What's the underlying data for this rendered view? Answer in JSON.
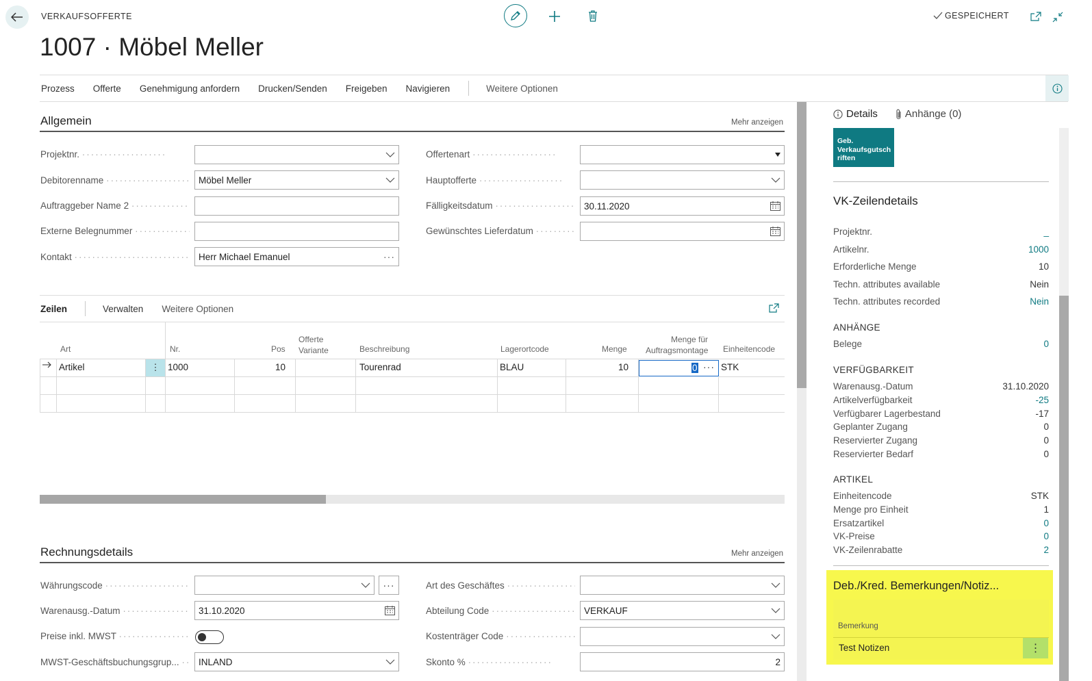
{
  "header": {
    "kicker": "VERKAUFSOFFERTE",
    "title": "1007 · Möbel Meller",
    "status": "GESPEICHERT"
  },
  "actions": {
    "items": [
      "Prozess",
      "Offerte",
      "Genehmigung anfordern",
      "Drucken/Senden",
      "Freigeben",
      "Navigieren"
    ],
    "more": "Weitere Optionen"
  },
  "general": {
    "title": "Allgemein",
    "more": "Mehr anzeigen",
    "left_fields": [
      {
        "label": "Projektnr.",
        "value": "",
        "control": "dropdown"
      },
      {
        "label": "Debitorenname",
        "value": "Möbel Meller",
        "control": "dropdown"
      },
      {
        "label": "Auftraggeber Name 2",
        "value": "",
        "control": "text"
      },
      {
        "label": "Externe Belegnummer",
        "value": "",
        "control": "text"
      },
      {
        "label": "Kontakt",
        "value": "Herr Michael Emanuel",
        "control": "ellipsis"
      }
    ],
    "right_fields": [
      {
        "label": "Offertenart",
        "value": "",
        "control": "select"
      },
      {
        "label": "Hauptofferte",
        "value": "",
        "control": "dropdown"
      },
      {
        "label": "Fälligkeitsdatum",
        "value": "30.11.2020",
        "control": "date"
      },
      {
        "label": "Gewünschtes Lieferdatum",
        "value": "",
        "control": "date"
      }
    ]
  },
  "lines": {
    "tab": "Zeilen",
    "manage": "Verwalten",
    "more": "Weitere Optionen",
    "columns": {
      "art": "Art",
      "nr": "Nr.",
      "pos": "Pos",
      "variante_1": "Offerte",
      "variante_2": "Variante",
      "beschreibung": "Beschreibung",
      "lagerort": "Lagerortcode",
      "menge": "Menge",
      "montage_1": "Menge für",
      "montage_2": "Auftragsmontage",
      "einheit": "Einheitencode"
    },
    "row": {
      "art": "Artikel",
      "nr": "1000",
      "pos": "10",
      "variante": "",
      "beschreibung": "Tourenrad",
      "lagerort": "BLAU",
      "menge": "10",
      "montage": "0",
      "einheit": "STK"
    }
  },
  "invoice": {
    "title": "Rechnungsdetails",
    "more": "Mehr anzeigen",
    "left_fields": [
      {
        "label": "Währungscode",
        "value": ""
      },
      {
        "label": "Warenausg.-Datum",
        "value": "31.10.2020"
      },
      {
        "label": "Preise inkl. MWST",
        "value": ""
      },
      {
        "label": "MWST-Geschäftsbuchungsgrup...",
        "value": "INLAND"
      }
    ],
    "right_fields": [
      {
        "label": "Art des Geschäftes",
        "value": ""
      },
      {
        "label": "Abteilung Code",
        "value": "VERKAUF"
      },
      {
        "label": "Kostenträger Code",
        "value": ""
      },
      {
        "label": "Skonto %",
        "value": "2"
      }
    ]
  },
  "panel": {
    "tab_details": "Details",
    "tab_attachments": "Anhänge (0)",
    "tile": "Geb. Verkaufsgutsch riften",
    "line_details_title": "VK-Zeilendetails",
    "line_details": [
      {
        "label": "Projektnr.",
        "value": "_",
        "link": true
      },
      {
        "label": "Artikelnr.",
        "value": "1000",
        "link": true
      },
      {
        "label": "Erforderliche Menge",
        "value": "10",
        "link": false
      },
      {
        "label": "Techn. attributes available",
        "value": "Nein",
        "link": false
      },
      {
        "label": "Techn. attributes recorded",
        "value": "Nein",
        "link": true
      }
    ],
    "attachments_caption": "ANHÄNGE",
    "attachments": [
      {
        "label": "Belege",
        "value": "0",
        "link": true
      }
    ],
    "availability_caption": "VERFÜGBARKEIT",
    "availability": [
      {
        "label": "Warenausg.-Datum",
        "value": "31.10.2020",
        "link": false
      },
      {
        "label": "Artikelverfügbarkeit",
        "value": "-25",
        "link": true
      },
      {
        "label": "Verfügbarer Lagerbestand",
        "value": "-17",
        "link": false
      },
      {
        "label": "Geplanter Zugang",
        "value": "0",
        "link": false
      },
      {
        "label": "Reservierter Zugang",
        "value": "0",
        "link": false
      },
      {
        "label": "Reservierter Bedarf",
        "value": "0",
        "link": false
      }
    ],
    "item_caption": "ARTIKEL",
    "item": [
      {
        "label": "Einheitencode",
        "value": "STK",
        "link": false
      },
      {
        "label": "Menge pro Einheit",
        "value": "1",
        "link": false
      },
      {
        "label": "Ersatzartikel",
        "value": "0",
        "link": true
      },
      {
        "label": "VK-Preise",
        "value": "0",
        "link": true
      },
      {
        "label": "VK-Zeilenrabatte",
        "value": "2",
        "link": true
      }
    ],
    "notes_title": "Deb./Kred. Bemerkungen/Notiz...",
    "notes_column": "Bemerkung",
    "notes_value": "Test Notizen"
  },
  "colors": {
    "accent": "#0f7a82",
    "highlight": "#f7f74d",
    "selected_cell": "#b9e3ea"
  }
}
